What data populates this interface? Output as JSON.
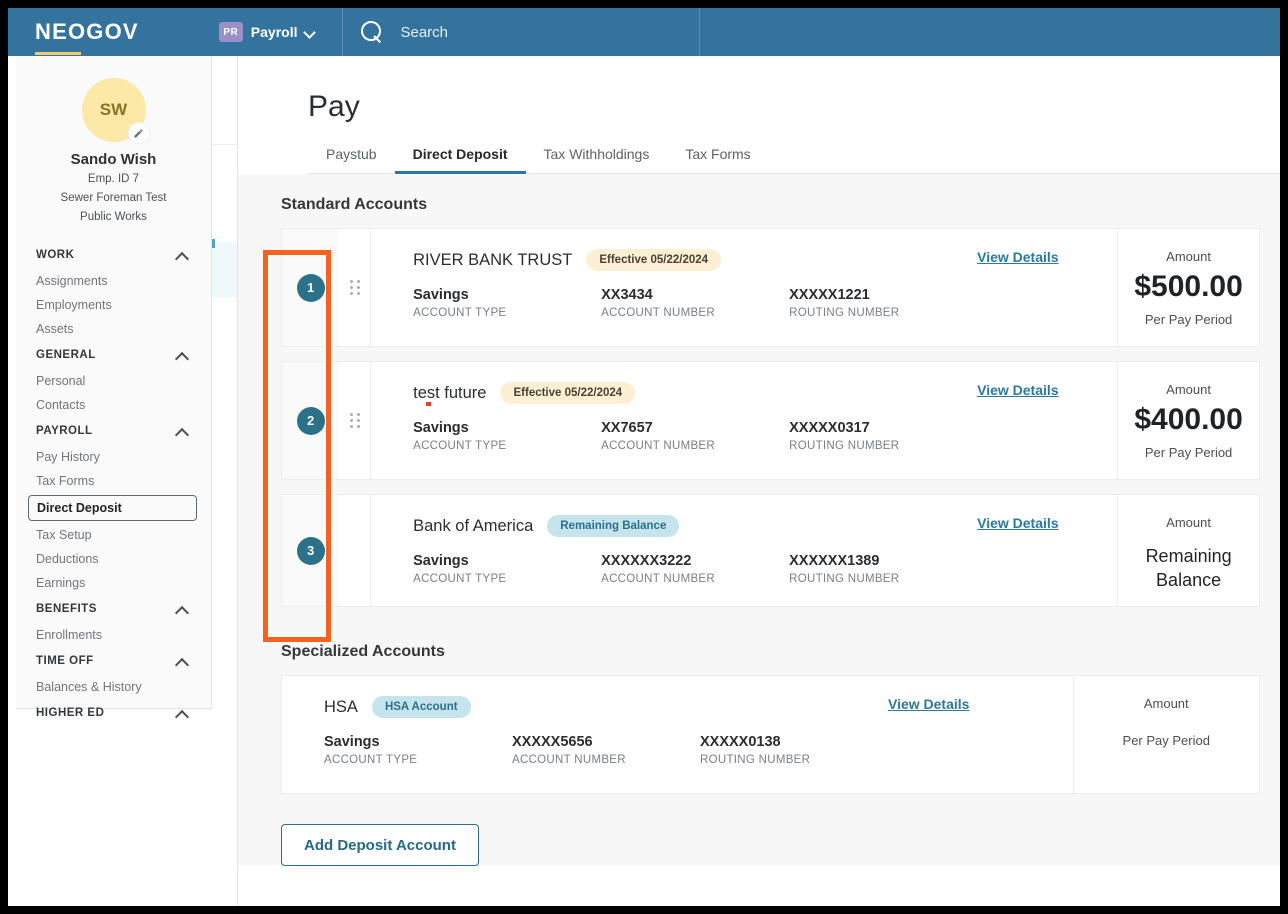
{
  "header": {
    "logo": "NEOGOV",
    "app_badge": "PR",
    "app_name": "Payroll",
    "search_placeholder": "Search"
  },
  "sidebar": {
    "profile": {
      "initials": "SW",
      "name": "Sando Wish",
      "emp_id": "Emp. ID 7",
      "title": "Sewer Foreman Test",
      "department": "Public Works"
    },
    "groups": [
      {
        "label": "WORK",
        "items": [
          "Assignments",
          "Employments",
          "Assets"
        ]
      },
      {
        "label": "GENERAL",
        "items": [
          "Personal",
          "Contacts"
        ]
      },
      {
        "label": "PAYROLL",
        "items": [
          "Pay History",
          "Tax Forms",
          "Direct Deposit",
          "Tax Setup",
          "Deductions",
          "Earnings"
        ]
      },
      {
        "label": "BENEFITS",
        "items": [
          "Enrollments"
        ]
      },
      {
        "label": "TIME OFF",
        "items": [
          "Balances & History"
        ]
      },
      {
        "label": "HIGHER ED",
        "items": []
      }
    ],
    "active_item": "Direct Deposit"
  },
  "main": {
    "title": "Pay",
    "tabs": [
      {
        "label": "Paystub",
        "active": false
      },
      {
        "label": "Direct Deposit",
        "active": true
      },
      {
        "label": "Tax Withholdings",
        "active": false
      },
      {
        "label": "Tax Forms",
        "active": false
      }
    ],
    "standard_section_title": "Standard Accounts",
    "specialized_section_title": "Specialized Accounts",
    "view_details_label": "View Details",
    "add_button_label": "Add Deposit Account",
    "labels": {
      "account_type": "ACCOUNT TYPE",
      "account_number": "ACCOUNT NUMBER",
      "routing_number": "ROUTING NUMBER",
      "amount": "Amount",
      "per_pay_period": "Per Pay Period"
    },
    "standard_accounts": [
      {
        "order": "1",
        "bank": "RIVER BANK TRUST",
        "badge": "Effective 05/22/2024",
        "badge_type": "effective",
        "account_type": "Savings",
        "account_number": "XX3434",
        "routing_number": "XXXXX1221",
        "amount": "$500.00",
        "amount_sub": "Per Pay Period"
      },
      {
        "order": "2",
        "bank": "test future",
        "badge": "Effective 05/22/2024",
        "badge_type": "effective",
        "account_type": "Savings",
        "account_number": "XX7657",
        "routing_number": "XXXXX0317",
        "amount": "$400.00",
        "amount_sub": "Per Pay Period"
      },
      {
        "order": "3",
        "bank": "Bank of America",
        "badge": "Remaining Balance",
        "badge_type": "remaining",
        "account_type": "Savings",
        "account_number": "XXXXXX3222",
        "routing_number": "XXXXXX1389",
        "amount": "Remaining Balance",
        "amount_sub": ""
      }
    ],
    "specialized_accounts": [
      {
        "bank": "HSA",
        "badge": "HSA Account",
        "badge_type": "hsa",
        "account_type": "Savings",
        "account_number": "XXXXX5656",
        "routing_number": "XXXXX0138",
        "amount": "",
        "amount_sub": "Per Pay Period"
      }
    ]
  },
  "annotation": {
    "color": "#F4621F"
  }
}
